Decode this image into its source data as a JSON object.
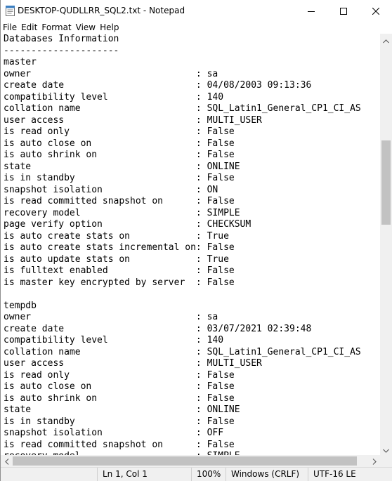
{
  "window": {
    "title": "DESKTOP-QUDLLRR_SQL2.txt - Notepad",
    "controls": [
      "minimize",
      "maximize",
      "close"
    ]
  },
  "menu": {
    "items": [
      "File",
      "Edit",
      "Format",
      "View",
      "Help"
    ]
  },
  "editor": {
    "lines": [
      "Databases Information",
      "---------------------",
      "master",
      "owner                              : sa",
      "create date                        : 04/08/2003 09:13:36",
      "compatibility level                : 140",
      "collation name                     : SQL_Latin1_General_CP1_CI_AS",
      "user access                        : MULTI_USER",
      "is read only                       : False",
      "is auto close on                   : False",
      "is auto shrink on                  : False",
      "state                              : ONLINE",
      "is in standby                      : False",
      "snapshot isolation                 : ON",
      "is read committed snapshot on      : False",
      "recovery model                     : SIMPLE",
      "page verify option                 : CHECKSUM",
      "is auto create stats on            : True",
      "is auto create stats incremental on: False",
      "is auto update stats on            : True",
      "is fulltext enabled                : False",
      "is master key encrypted by server  : False",
      "",
      "tempdb",
      "owner                              : sa",
      "create date                        : 03/07/2021 02:39:48",
      "compatibility level                : 140",
      "collation name                     : SQL_Latin1_General_CP1_CI_AS",
      "user access                        : MULTI_USER",
      "is read only                       : False",
      "is auto close on                   : False",
      "is auto shrink on                  : False",
      "state                              : ONLINE",
      "is in standby                      : False",
      "snapshot isolation                 : OFF",
      "is read committed snapshot on      : False",
      "recovery model                     : SIMPLE"
    ]
  },
  "statusbar": {
    "position": "Ln 1, Col 1",
    "zoom": "100%",
    "line_endings": "Windows (CRLF)",
    "encoding": "UTF-16 LE"
  },
  "colors": {
    "scrollbar_track": "#f0f0f0",
    "scrollbar_thumb": "#c2c2c2",
    "statusbar_bg": "#f0f0f0"
  }
}
